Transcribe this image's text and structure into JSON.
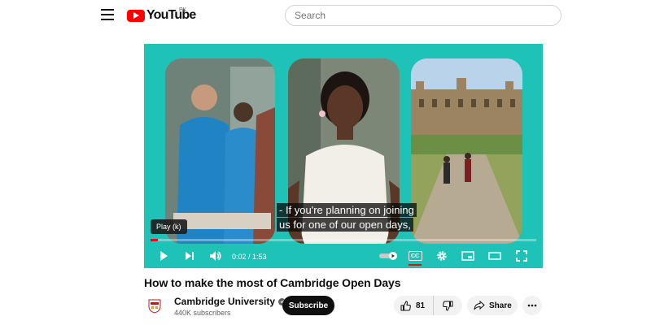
{
  "header": {
    "logo_text": "YouTube",
    "country_code": "PK",
    "search_placeholder": "Search"
  },
  "player": {
    "subtitle_line1": "- If you're planning on joining",
    "subtitle_line2": "us for one of our open days,",
    "tooltip": "Play (k)",
    "time": "0:02 / 1:53",
    "progress": 0.02,
    "cc_label": "CC",
    "colors": {
      "background": "#1fc2b6",
      "progress": "#ff0000"
    }
  },
  "video": {
    "title": "How to make the most of Cambridge Open Days"
  },
  "channel": {
    "name": "Cambridge University",
    "subscribers": "440K subscribers",
    "subscribe_label": "Subscribe"
  },
  "actions": {
    "like_count": "81",
    "share_label": "Share"
  }
}
